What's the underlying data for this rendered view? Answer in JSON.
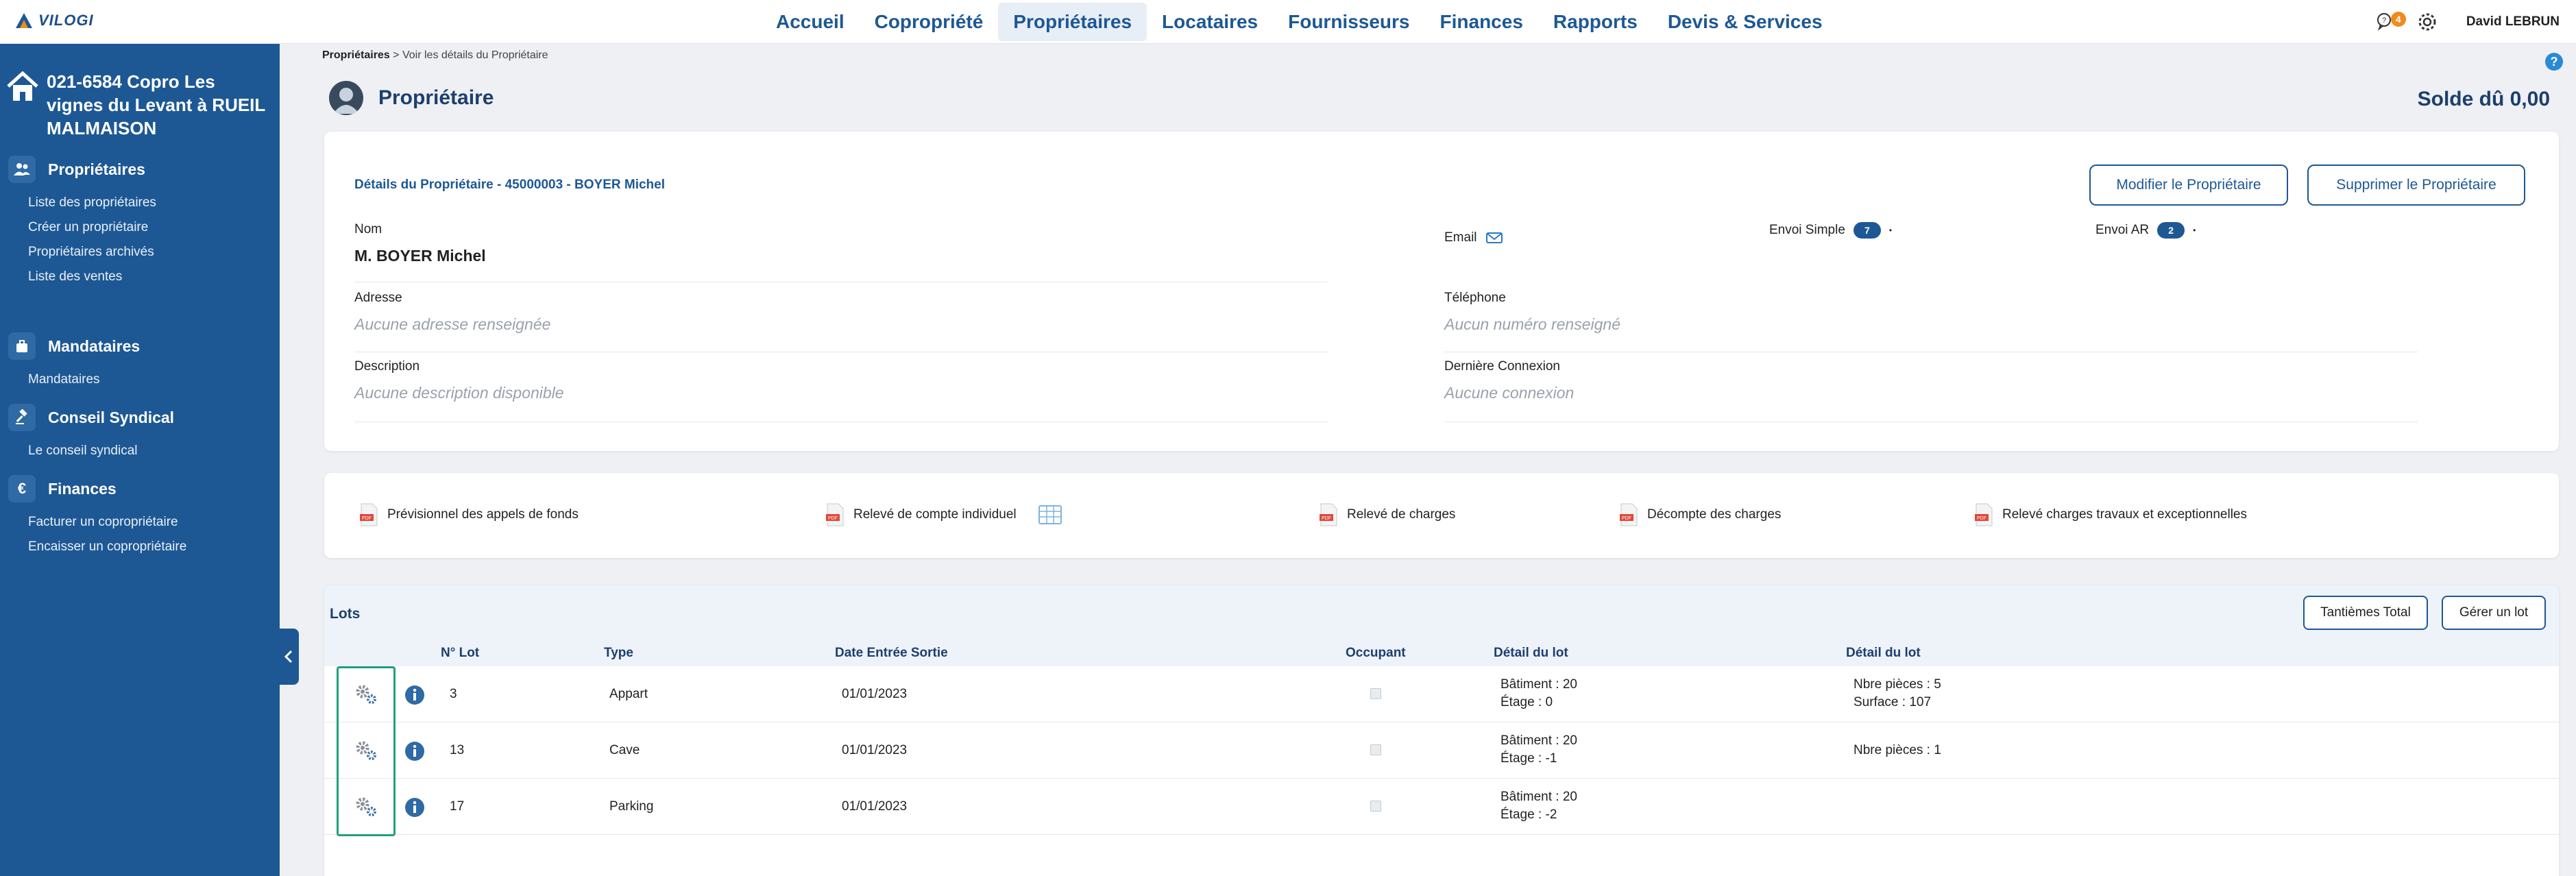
{
  "app": {
    "logo_text": "VILOGI"
  },
  "nav": {
    "items": [
      "Accueil",
      "Copropriété",
      "Propriétaires",
      "Locataires",
      "Fournisseurs",
      "Finances",
      "Rapports",
      "Devis & Services"
    ],
    "active": "Propriétaires"
  },
  "topbar": {
    "notification_count": "4",
    "user_name": "David LEBRUN"
  },
  "sidebar": {
    "building": "021-6584 Copro Les vignes du Levant à RUEIL MALMAISON",
    "sections": [
      {
        "title": "Propriétaires",
        "icon": "users-icon",
        "links": [
          "Liste des propriétaires",
          "Créer un propriétaire",
          "Propriétaires archivés",
          "Liste des ventes"
        ]
      },
      {
        "title": "Mandataires",
        "icon": "briefcase-icon",
        "links": [
          "Mandataires"
        ]
      },
      {
        "title": "Conseil Syndical",
        "icon": "gavel-icon",
        "links": [
          "Le conseil syndical"
        ]
      },
      {
        "title": "Finances",
        "icon": "euro-icon",
        "links": [
          "Facturer un copropriétaire",
          "Encaisser un copropriétaire"
        ]
      }
    ]
  },
  "breadcrumb": {
    "root": "Propriétaires",
    "separator": ">",
    "current": "Voir les détails du Propriétaire"
  },
  "page": {
    "title": "Propriétaire",
    "balance": "Solde dû 0,00"
  },
  "owner": {
    "details_title": "Détails du Propriétaire - 45000003 - BOYER Michel",
    "edit_button": "Modifier le Propriétaire",
    "delete_button": "Supprimer le Propriétaire",
    "name_label": "Nom",
    "name_value": "M. BOYER Michel",
    "address_label": "Adresse",
    "address_value": "Aucune adresse renseignée",
    "description_label": "Description",
    "description_value": "Aucune description disponible",
    "email_label": "Email",
    "envoi_simple_label": "Envoi Simple",
    "envoi_simple_count": "7",
    "envoi_ar_label": "Envoi AR",
    "envoi_ar_count": "2",
    "phone_label": "Téléphone",
    "phone_value": "Aucun numéro renseigné",
    "last_login_label": "Dernière Connexion",
    "last_login_value": "Aucune connexion"
  },
  "documents": [
    "Prévisionnel des appels de fonds",
    "Relevé de compte individuel",
    "Relevé de charges",
    "Décompte des charges",
    "Relevé charges travaux et exceptionnelles"
  ],
  "lots": {
    "title": "Lots",
    "btn_tantiemes": "Tantièmes Total",
    "btn_manage": "Gérer un lot",
    "headers": [
      "N° Lot",
      "Type",
      "Date Entrée Sortie",
      "Occupant",
      "Détail du lot",
      "Détail du lot"
    ],
    "rows": [
      {
        "num": "3",
        "type": "Appart",
        "date": "01/01/2023",
        "batiment": "Bâtiment : 20",
        "etage": "Étage : 0",
        "detail1": "Nbre pièces : 5",
        "detail2": "Surface : 107"
      },
      {
        "num": "13",
        "type": "Cave",
        "date": "01/01/2023",
        "batiment": "Bâtiment : 20",
        "etage": "Étage : -1",
        "detail1": "Nbre pièces : 1",
        "detail2": ""
      },
      {
        "num": "17",
        "type": "Parking",
        "date": "01/01/2023",
        "batiment": "Bâtiment : 20",
        "etage": "Étage : -2",
        "detail1": "",
        "detail2": ""
      }
    ]
  },
  "colors": {
    "primary": "#1d5894",
    "accent_badge": "#f18a1c",
    "frame_green": "#21a07a"
  }
}
